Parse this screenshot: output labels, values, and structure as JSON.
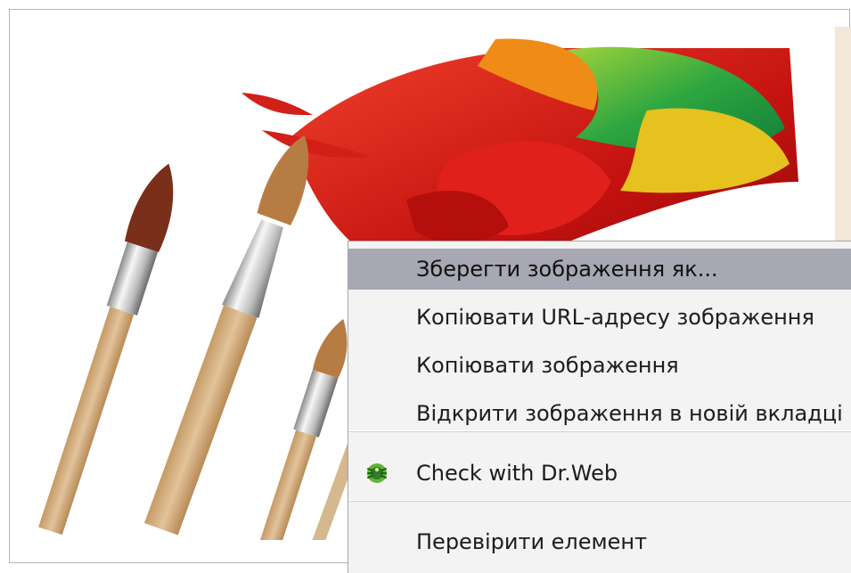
{
  "context_menu": {
    "items": [
      {
        "label": "Зберегти зображення як...",
        "highlighted": true
      },
      {
        "label": "Копіювати URL-адресу зображення",
        "highlighted": false
      },
      {
        "label": "Копіювати зображення",
        "highlighted": false
      },
      {
        "label": "Відкрити зображення в новій вкладці",
        "highlighted": false
      },
      {
        "label": "Check with Dr.Web",
        "icon": "drweb-spider-icon",
        "highlighted": false
      },
      {
        "label": "Перевірити елемент",
        "highlighted": false
      }
    ]
  },
  "image": {
    "subject": "paint-brushes-and-paint-strokes",
    "colors": {
      "background": "#ffffff",
      "accent_red": "#d41d16",
      "accent_green": "#3db54a",
      "accent_yellow": "#ecd12d",
      "frame": "#b5b5b5",
      "menu_highlight": "#a7a8b3",
      "menu_background": "#f3f3f3"
    }
  }
}
